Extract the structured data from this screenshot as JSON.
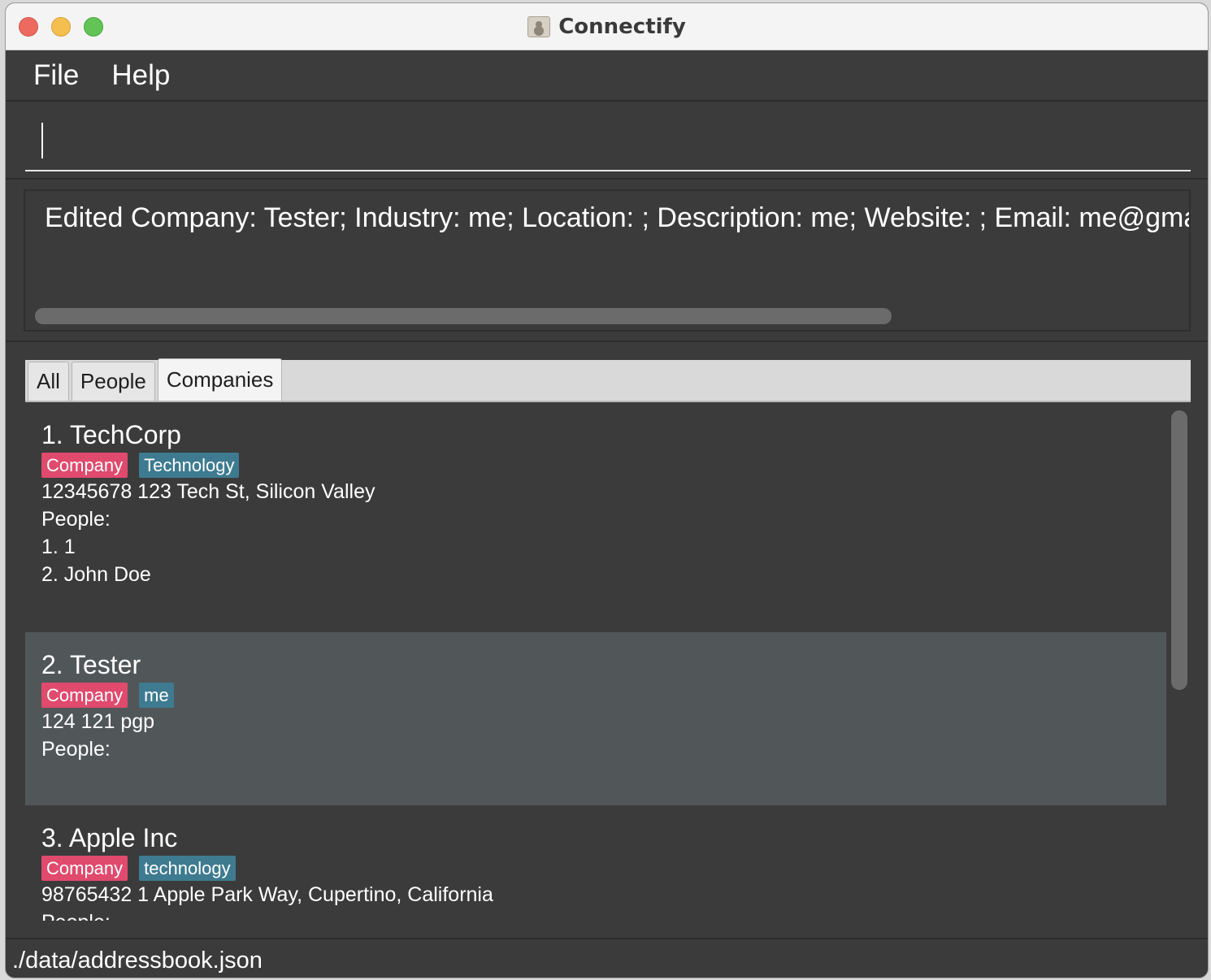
{
  "window": {
    "title": "Connectify"
  },
  "menu": {
    "file": "File",
    "help": "Help"
  },
  "command": {
    "value": ""
  },
  "result": {
    "text": "Edited Company: Tester; Industry: me; Location: ; Description: me; Website: ; Email: me@gmail.con"
  },
  "tabs": [
    {
      "label": "All",
      "active": false
    },
    {
      "label": "People",
      "active": false
    },
    {
      "label": "Companies",
      "active": true
    }
  ],
  "companies": [
    {
      "title": "1.  TechCorp",
      "tags": [
        "Company",
        "Technology"
      ],
      "details": "12345678  123 Tech St, Silicon Valley",
      "people_label": "People:",
      "people": [
        "1. 1",
        "2. John Doe"
      ]
    },
    {
      "title": "2.  Tester",
      "tags": [
        "Company",
        "me"
      ],
      "details": "124  121 pgp",
      "people_label": "People:",
      "people": []
    },
    {
      "title": "3.  Apple Inc",
      "tags": [
        "Company",
        "technology"
      ],
      "details": "98765432  1 Apple Park Way, Cupertino, California",
      "people_label": "People:",
      "people": []
    }
  ],
  "status": {
    "path": "./data/addressbook.json"
  },
  "colors": {
    "company_tag": "#e04a6d",
    "industry_tag": "#3e7b91",
    "selected_card": "#515759",
    "background": "#3b3b3c"
  }
}
